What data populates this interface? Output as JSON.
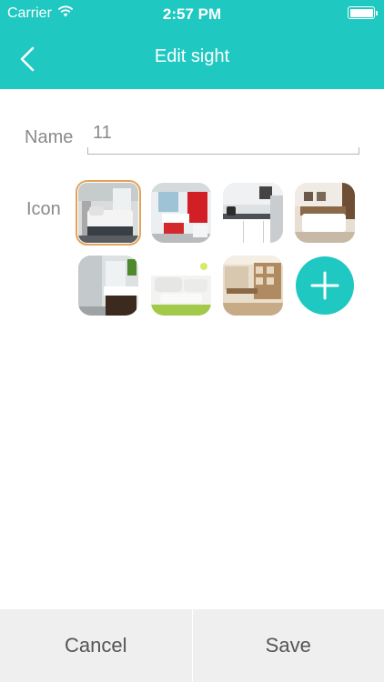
{
  "status_bar": {
    "carrier": "Carrier",
    "time": "2:57 PM",
    "battery_level": 1.0
  },
  "nav": {
    "title": "Edit sight",
    "back_icon": "chevron-left-icon"
  },
  "form": {
    "name_label": "Name",
    "name_value": "11",
    "icon_label": "Icon"
  },
  "icons": [
    {
      "name": "bedroom-white",
      "selected": true
    },
    {
      "name": "kitchen-red",
      "selected": false
    },
    {
      "name": "kitchen-gray",
      "selected": false
    },
    {
      "name": "bedroom-wood",
      "selected": false
    },
    {
      "name": "bathroom",
      "selected": false
    },
    {
      "name": "living-room",
      "selected": false
    },
    {
      "name": "study-room",
      "selected": false
    }
  ],
  "add_icon": "plus-icon",
  "footer": {
    "cancel_label": "Cancel",
    "save_label": "Save"
  },
  "colors": {
    "accent": "#1fc8c1",
    "selected_border": "#e3a35b",
    "label_text": "#8a8a8a",
    "footer_bg": "#efefef"
  }
}
